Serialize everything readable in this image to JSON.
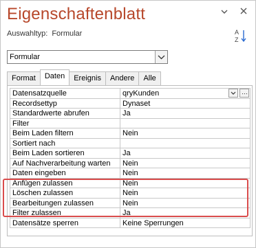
{
  "panel": {
    "title": "Eigenschaftenblatt",
    "selection_label": "Auswahltyp:",
    "selection_value": "Formular"
  },
  "object_combo": {
    "value": "Formular"
  },
  "tabs": [
    {
      "label": "Format",
      "active": false
    },
    {
      "label": "Daten",
      "active": true
    },
    {
      "label": "Ereignis",
      "active": false
    },
    {
      "label": "Andere",
      "active": false
    },
    {
      "label": "Alle",
      "active": false
    }
  ],
  "properties": [
    {
      "name": "Datensatzquelle",
      "value": "qryKunden"
    },
    {
      "name": "Recordsettyp",
      "value": "Dynaset"
    },
    {
      "name": "Standardwerte abrufen",
      "value": "Ja"
    },
    {
      "name": "Filter",
      "value": ""
    },
    {
      "name": "Beim Laden filtern",
      "value": "Nein"
    },
    {
      "name": "Sortiert nach",
      "value": ""
    },
    {
      "name": "Beim Laden sortieren",
      "value": "Ja"
    },
    {
      "name": "Auf Nachverarbeitung warten",
      "value": "Nein"
    },
    {
      "name": "Daten eingeben",
      "value": "Nein"
    },
    {
      "name": "Anfügen zulassen",
      "value": "Nein"
    },
    {
      "name": "Löschen zulassen",
      "value": "Nein"
    },
    {
      "name": "Bearbeitungen zulassen",
      "value": "Nein"
    },
    {
      "name": "Filter zulassen",
      "value": "Ja"
    },
    {
      "name": "Datensätze sperren",
      "value": "Keine Sperrungen"
    }
  ],
  "colors": {
    "title": "#b7472a",
    "highlight": "#d94b4b"
  },
  "icons": {
    "dropdown": "chevron-down-icon",
    "close": "close-icon",
    "sort": "sort-az-icon",
    "builder": "ellipsis-icon"
  }
}
